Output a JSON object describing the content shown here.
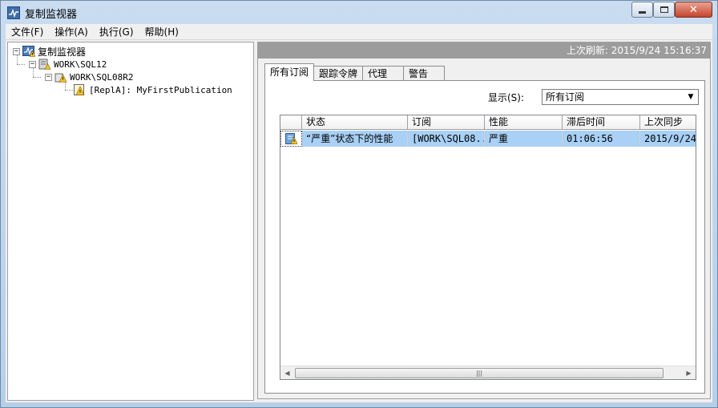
{
  "window": {
    "title": "复制监视器",
    "icon": "replication-monitor-icon"
  },
  "menu": [
    {
      "label": "文件(F)"
    },
    {
      "label": "操作(A)"
    },
    {
      "label": "执行(G)"
    },
    {
      "label": "帮助(H)"
    }
  ],
  "tree": {
    "root": {
      "label": "复制监视器",
      "expander": "−"
    },
    "server": {
      "label": "WORK\\SQL12",
      "expander": "−"
    },
    "publisher": {
      "label": "WORK\\SQL08R2",
      "expander": "−"
    },
    "publication": {
      "label": "[ReplA]: MyFirstPublication"
    }
  },
  "right": {
    "refresh": "上次刷新: 2015/9/24 15:16:37",
    "tabs": [
      {
        "label": "所有订阅"
      },
      {
        "label": "跟踪令牌"
      },
      {
        "label": "代理"
      },
      {
        "label": "警告"
      }
    ],
    "show_label": "显示(S):",
    "show_value": "所有订阅",
    "grid": {
      "columns": [
        "状态",
        "订阅",
        "性能",
        "滞后时间",
        "上次同步"
      ],
      "rows": [
        {
          "status": "“严重”状态下的性能",
          "subscription": "[WORK\\SQL08...",
          "performance": "严重",
          "latency": "01:06:56",
          "last_sync": "2015/9/24 1"
        }
      ]
    }
  },
  "colors": {
    "selection": "#a9d0f5",
    "refresh_bar": "#9c9c9c",
    "warning": "#f2c12e"
  }
}
